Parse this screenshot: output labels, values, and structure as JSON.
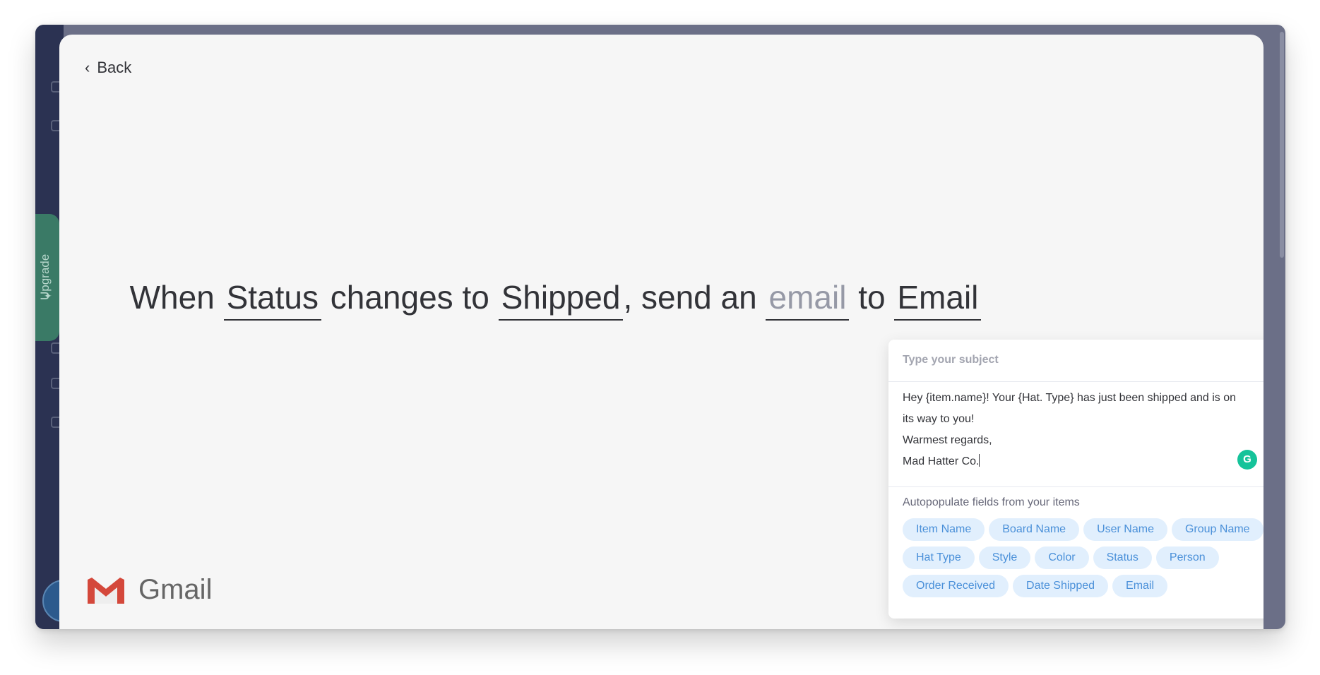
{
  "back": {
    "label": "Back"
  },
  "sidebar": {
    "upgrade_label": "Upgrade"
  },
  "recipe": {
    "p1": "When ",
    "trigger_column": "Status",
    "p2": " changes to ",
    "trigger_value": "Shipped",
    "p3": ", send an ",
    "action": "email",
    "p4": " to ",
    "recipient": "Email"
  },
  "brand": {
    "name": "Gmail"
  },
  "email_editor": {
    "subject_placeholder": "Type your subject",
    "body_lines": [
      "Hey {item.name}! Your {Hat. Type} has just been shipped and is on",
      "its way to you!",
      "Warmest regards,",
      "Mad Hatter Co."
    ],
    "grammarly_letter": "G",
    "autopopulate_label": "Autopopulate fields from your items",
    "fields": [
      "Item Name",
      "Board Name",
      "User Name",
      "Group Name",
      "Hat Type",
      "Style",
      "Color",
      "Status",
      "Person",
      "Order Received",
      "Date Shipped",
      "Email"
    ]
  },
  "colors": {
    "sidebar": "#2b3252",
    "upgrade": "#3a7a66",
    "chip_bg": "#e1effd",
    "chip_text": "#4a90d9",
    "grammarly": "#15c39a"
  }
}
